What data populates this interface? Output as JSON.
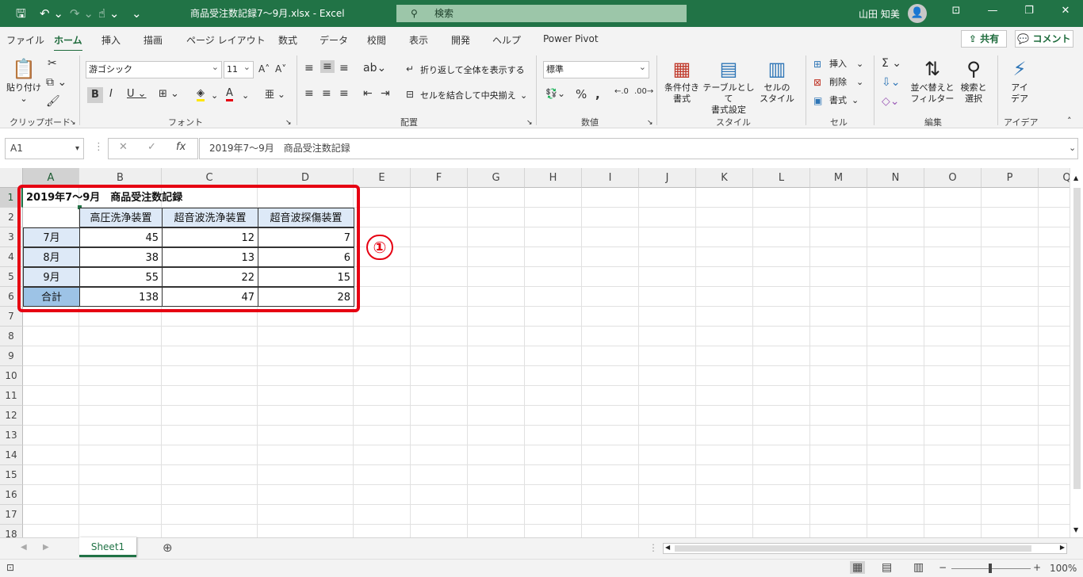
{
  "titlebar": {
    "title": "商品受注数記録7～9月.xlsx  -  Excel",
    "search_placeholder": "検索",
    "user": "山田 知美",
    "bg": "#217346"
  },
  "menu": {
    "items": [
      "ファイル",
      "ホーム",
      "挿入",
      "描画",
      "ページ レイアウト",
      "数式",
      "データ",
      "校閲",
      "表示",
      "開発",
      "ヘルプ",
      "Power Pivot"
    ],
    "share": "共有",
    "comment": "コメント"
  },
  "ribbon": {
    "clipboard": {
      "paste": "貼り付け",
      "label": "クリップボード"
    },
    "font": {
      "name": "游ゴシック",
      "size": "11",
      "label": "フォント"
    },
    "align": {
      "wrap": "折り返して全体を表示する",
      "merge": "セルを結合して中央揃え",
      "label": "配置"
    },
    "number": {
      "format": "標準",
      "label": "数値"
    },
    "style": {
      "cond": "条件付き\n書式",
      "table": "テーブルとして\n書式設定",
      "cell": "セルの\nスタイル",
      "label": "スタイル"
    },
    "cells": {
      "insert": "挿入",
      "delete": "削除",
      "format": "書式",
      "label": "セル"
    },
    "edit": {
      "sort": "並べ替えと\nフィルター",
      "find": "検索と\n選択",
      "label": "編集"
    },
    "ideas": {
      "ideas": "アイ\nデア",
      "label": "アイデア"
    }
  },
  "formula": {
    "namebox": "A1",
    "fx": "fx",
    "content": "2019年7～9月　商品受注数記録"
  },
  "columns": [
    "A",
    "B",
    "C",
    "D",
    "E",
    "F",
    "G",
    "H",
    "I",
    "J",
    "K",
    "L",
    "M",
    "N",
    "O",
    "P",
    "Q"
  ],
  "rows": [
    "1",
    "2",
    "3",
    "4",
    "5",
    "6",
    "7",
    "8",
    "9",
    "10",
    "11",
    "12",
    "13",
    "14",
    "15",
    "16",
    "17",
    "18"
  ],
  "table": {
    "title": "2019年7～9月　商品受注数記録",
    "headers": [
      "高圧洗浄装置",
      "超音波洗浄装置",
      "超音波探傷装置"
    ],
    "data": [
      {
        "month": "7月",
        "v": [
          "45",
          "12",
          "7"
        ]
      },
      {
        "month": "8月",
        "v": [
          "38",
          "13",
          "6"
        ]
      },
      {
        "month": "9月",
        "v": [
          "55",
          "22",
          "15"
        ]
      },
      {
        "month": "合計",
        "v": [
          "138",
          "47",
          "28"
        ]
      }
    ]
  },
  "annotation": {
    "marker": "①",
    "color": "#e60012"
  },
  "sheets": [
    "Sheet1"
  ],
  "status": {
    "zoom": "100%"
  }
}
